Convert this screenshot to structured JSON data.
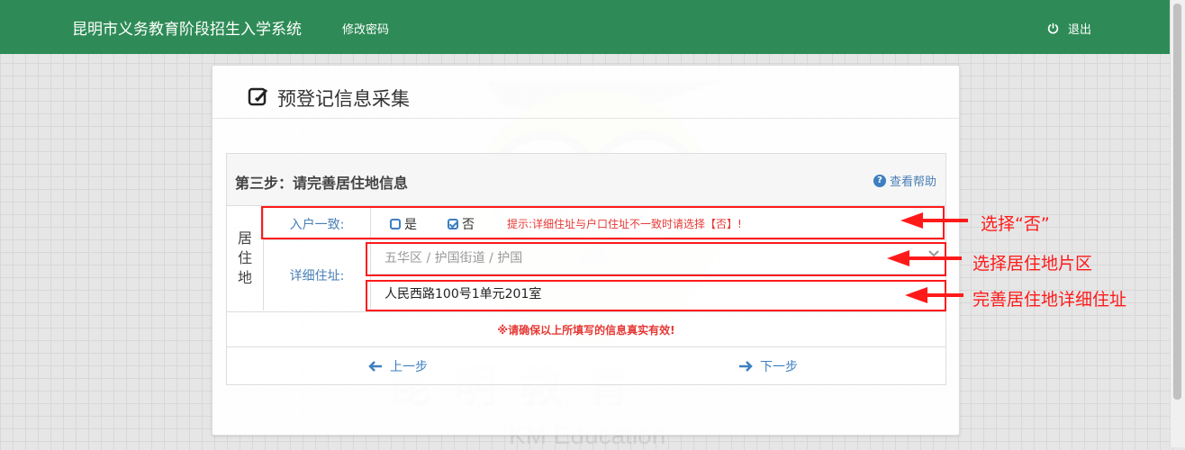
{
  "navbar": {
    "brand": "昆明市义务教育阶段招生入学系统",
    "change_password": "修改密码",
    "logout": "退出",
    "power_icon": "power-icon"
  },
  "card": {
    "title": "预登记信息采集",
    "title_icon": "edit-icon"
  },
  "step": {
    "title": "第三步：请完善居住地信息",
    "help": "查看帮助"
  },
  "residence": {
    "section_label": [
      "居",
      "住",
      "地"
    ],
    "same_as_household_label": "入户一致:",
    "option_yes": "是",
    "option_no": "否",
    "selected": "否",
    "hint": "提示:详细住址与户口住址不一致时请选择【否】!",
    "address_label": "详细住址:",
    "district_select": "五华区 / 护国街道 / 护国",
    "address_value": "人民西路100号1单元201室"
  },
  "notice": "※请确保以上所填写的信息真实有效!",
  "buttons": {
    "prev": "上一步",
    "next": "下一步"
  },
  "annotations": {
    "note1": "选择“否”",
    "note2": "选择居住地片区",
    "note3": "完善居住地详细住址",
    "color": "#ff1a1a"
  },
  "watermark": {
    "text_cn": "昆明教育",
    "text_en": "KM Education"
  },
  "colors": {
    "navbar": "#2e8b57",
    "link": "#3c7fc0",
    "alert": "#e53935"
  }
}
